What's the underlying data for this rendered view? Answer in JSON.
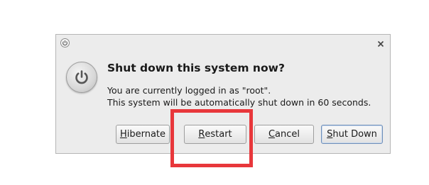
{
  "dialog": {
    "title_icon": "power-icon",
    "close_icon": "close-icon",
    "big_icon": "power-icon",
    "heading": "Shut down this system now?",
    "message_line1": "You are currently logged in as \"root\".",
    "message_line2": "This system will be automatically shut down in 60 seconds."
  },
  "buttons": {
    "hibernate": {
      "mnemonic": "H",
      "rest": "ibernate"
    },
    "restart": {
      "mnemonic": "R",
      "rest": "estart"
    },
    "cancel": {
      "mnemonic": "C",
      "rest": "ancel"
    },
    "shutdown": {
      "mnemonic": "S",
      "rest": "hut Down"
    }
  },
  "colors": {
    "highlight": "#e8373b",
    "dialog_bg": "#ececec"
  }
}
